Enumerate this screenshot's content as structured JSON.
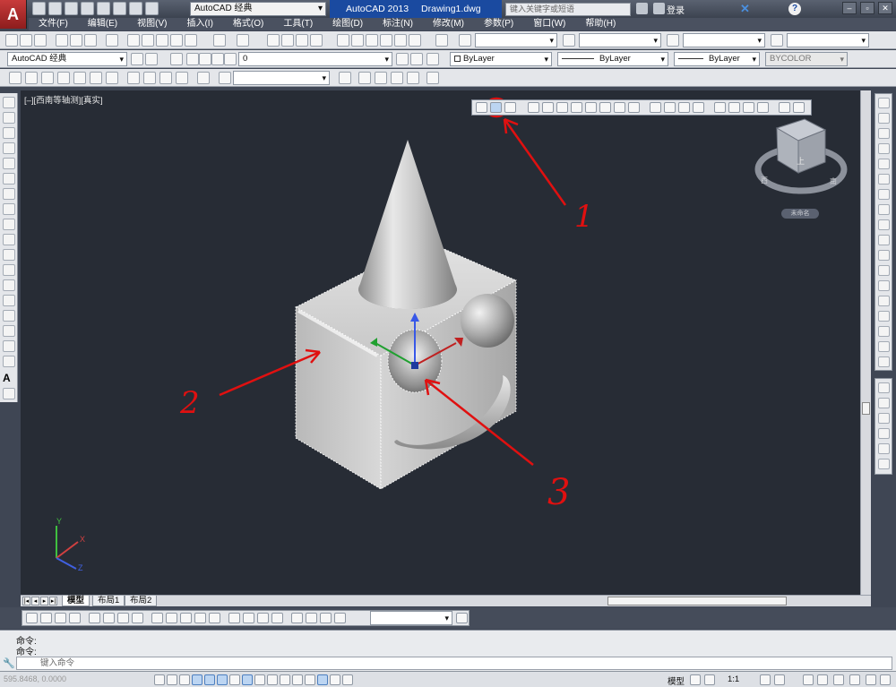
{
  "titlebar": {
    "workspace": "AutoCAD 经典",
    "app_name": "AutoCAD 2013",
    "file_name": "Drawing1.dwg",
    "search_placeholder": "键入关键字或短语",
    "login_label": "登录",
    "help_label": "?"
  },
  "menu": [
    "文件(F)",
    "编辑(E)",
    "视图(V)",
    "插入(I)",
    "格式(O)",
    "工具(T)",
    "绘图(D)",
    "标注(N)",
    "修改(M)",
    "参数(P)",
    "窗口(W)",
    "帮助(H)"
  ],
  "toolbar": {
    "workspace_combo": "AutoCAD 经典",
    "layer_combo": "0",
    "color_combo": "ByLayer",
    "linetype_combo": "ByLayer",
    "lineweight_combo": "ByLayer",
    "plotstyle_combo": "BYCOLOR"
  },
  "canvas": {
    "viewport_label": "[–][西南等轴测][真实]",
    "background": "#272c35",
    "viewcube_label": "未命名",
    "viewcube_face": "上",
    "viewcube_west": "西",
    "viewcube_south": "南",
    "ucs_x": "X",
    "ucs_y": "Y",
    "ucs_z": "Z",
    "annotations": [
      "1",
      "2",
      "3"
    ],
    "annotation_color": "#e01010"
  },
  "tabs": [
    "模型",
    "布局1",
    "布局2"
  ],
  "command": {
    "history": [
      "命令:",
      "命令:"
    ],
    "input_placeholder": "键入命令"
  },
  "status": {
    "coords": "595.8468, 0.0000",
    "model_label": "模型",
    "scale_label": "1:1"
  }
}
